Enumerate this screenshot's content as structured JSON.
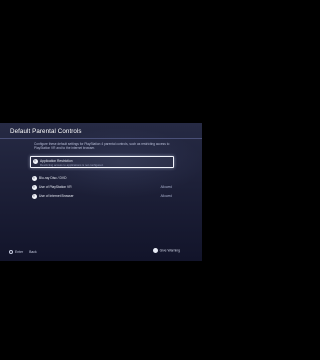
{
  "screen": {
    "title": "Default Parental Controls"
  },
  "description": "Configure these default settings for PlayStation 4 parental controls, such as restricting access to PlayStation VR and to the internet browser.",
  "settings": [
    {
      "bullet_icon": "exclamation-icon",
      "label": "Application Restriction",
      "value": "",
      "selected": true,
      "subtext": "Restricting access to applications is not configured."
    },
    {
      "bullet_icon": "exclamation-icon",
      "label": "Blu-ray Disc / DVD",
      "value": "",
      "selected": false,
      "subtext": ""
    },
    {
      "bullet_icon": "exclamation-icon",
      "label": "Use of PlayStation VR",
      "value": "Allowed",
      "selected": false,
      "subtext": ""
    },
    {
      "bullet_icon": "exclamation-icon",
      "label": "Use of Internet Browser",
      "value": "Allowed",
      "selected": false,
      "subtext": ""
    }
  ],
  "footer": {
    "back_label": "Back",
    "enter_label": "Enter",
    "options_label": "Give Warning"
  },
  "colors": {
    "background_top": "#262a44",
    "background_bottom": "#12142a",
    "selection_border": "#f2f4fb",
    "letterbox": "#000000"
  }
}
